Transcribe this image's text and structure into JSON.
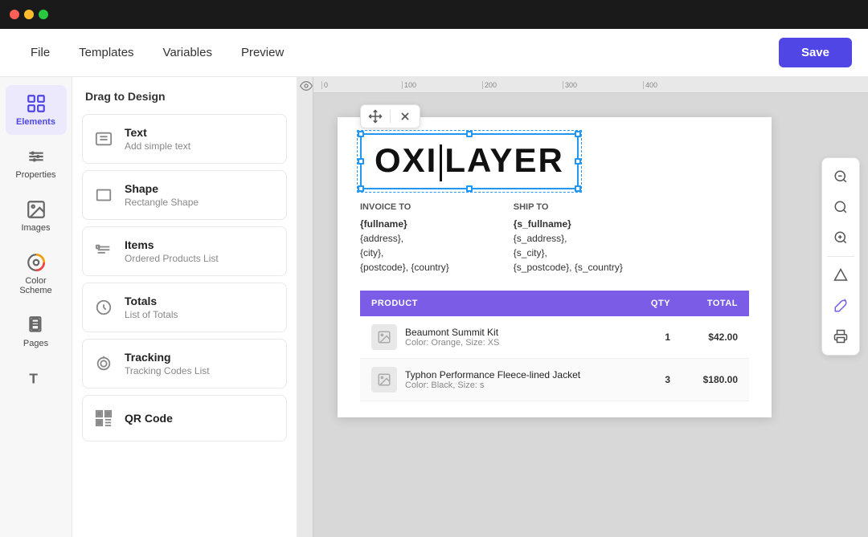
{
  "titleBar": {
    "lights": [
      "red",
      "yellow",
      "green"
    ]
  },
  "topNav": {
    "items": [
      "File",
      "Templates",
      "Variables",
      "Preview"
    ],
    "saveLabel": "Save"
  },
  "iconSidebar": {
    "items": [
      {
        "id": "elements",
        "label": "Elements",
        "active": true
      },
      {
        "id": "properties",
        "label": "Properties",
        "active": false
      },
      {
        "id": "images",
        "label": "Images",
        "active": false
      },
      {
        "id": "color-scheme",
        "label": "Color Scheme",
        "active": false
      },
      {
        "id": "pages",
        "label": "Pages",
        "active": false
      },
      {
        "id": "text-extra",
        "label": "",
        "active": false
      }
    ]
  },
  "elementsPanel": {
    "title": "Drag to Design",
    "elements": [
      {
        "id": "text",
        "name": "Text",
        "sub": "Add simple text"
      },
      {
        "id": "shape",
        "name": "Shape",
        "sub": "Rectangle Shape"
      },
      {
        "id": "items",
        "name": "Items",
        "sub": "Ordered Products List"
      },
      {
        "id": "totals",
        "name": "Totals",
        "sub": "List of Totals"
      },
      {
        "id": "tracking",
        "name": "Tracking",
        "sub": "Tracking Codes List"
      },
      {
        "id": "qrcode",
        "name": "QR Code",
        "sub": ""
      }
    ]
  },
  "ruler": {
    "marks": [
      "0",
      "100",
      "200",
      "300",
      "400"
    ]
  },
  "document": {
    "logoText": "OXI|LAYER",
    "invoiceTo": {
      "title": "INVOICE TO",
      "lines": [
        "{fullname}",
        "{address},",
        "{city},",
        "{postcode}, {country}"
      ]
    },
    "shipTo": {
      "title": "SHIP TO",
      "lines": [
        "{s_fullname}",
        "{s_address},",
        "{s_city},",
        "{s_postcode}, {s_country}"
      ]
    },
    "table": {
      "headers": [
        "PRODUCT",
        "QTY",
        "TOTAL"
      ],
      "rows": [
        {
          "name": "Beaumont Summit Kit",
          "sub": "Color: Orange, Size: XS",
          "qty": "1",
          "total": "$42.00"
        },
        {
          "name": "Typhon Performance Fleece-lined Jacket",
          "sub": "Color: Black, Size: s",
          "qty": "3",
          "total": "$180.00"
        }
      ]
    }
  },
  "rightToolbar": {
    "buttons": [
      {
        "id": "zoom-out",
        "icon": "minus-circle"
      },
      {
        "id": "zoom-fit",
        "icon": "search"
      },
      {
        "id": "zoom-in",
        "icon": "plus-circle"
      },
      {
        "id": "triangle",
        "icon": "triangle"
      },
      {
        "id": "paint",
        "icon": "paint"
      },
      {
        "id": "printer",
        "icon": "printer"
      }
    ]
  }
}
